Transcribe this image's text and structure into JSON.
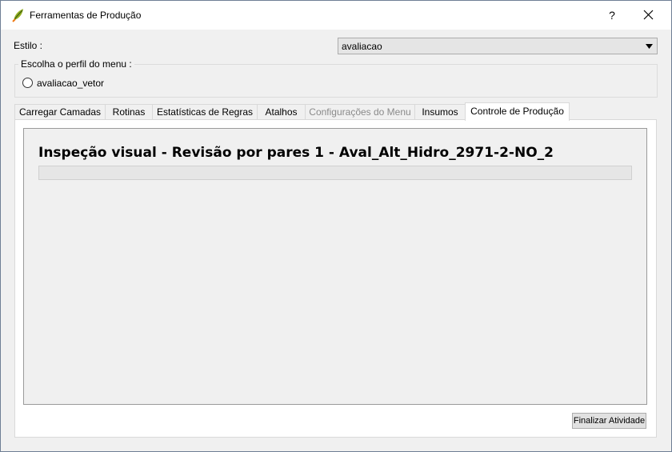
{
  "window": {
    "title": "Ferramentas de Produção",
    "help_label": "?",
    "icon": "qgis-leaf-icon",
    "close_icon": "close-icon"
  },
  "style": {
    "label": "Estilo :",
    "selected": "avaliacao"
  },
  "profile_group": {
    "legend": "Escolha o perfil do menu :",
    "options": [
      {
        "label": "avaliacao_vetor",
        "checked": false
      }
    ]
  },
  "tabs": [
    {
      "label": "Carregar Camadas",
      "enabled": true,
      "active": false
    },
    {
      "label": "Rotinas",
      "enabled": true,
      "active": false
    },
    {
      "label": "Estatísticas de Regras",
      "enabled": true,
      "active": false
    },
    {
      "label": "Atalhos",
      "enabled": true,
      "active": false
    },
    {
      "label": "Configurações do Menu",
      "enabled": false,
      "active": false
    },
    {
      "label": "Insumos",
      "enabled": true,
      "active": false
    },
    {
      "label": "Controle de Produção",
      "enabled": true,
      "active": true
    }
  ],
  "production": {
    "activity_title": "Inspeção visual - Revisão por pares 1 - Aval_Alt_Hidro_2971-2-NO_2",
    "progress": 0,
    "finish_button": "Finalizar Atividade"
  },
  "colors": {
    "window_bg": "#f0f0f0",
    "panel_bg": "#ffffff",
    "progress_fill": "#06b025"
  }
}
